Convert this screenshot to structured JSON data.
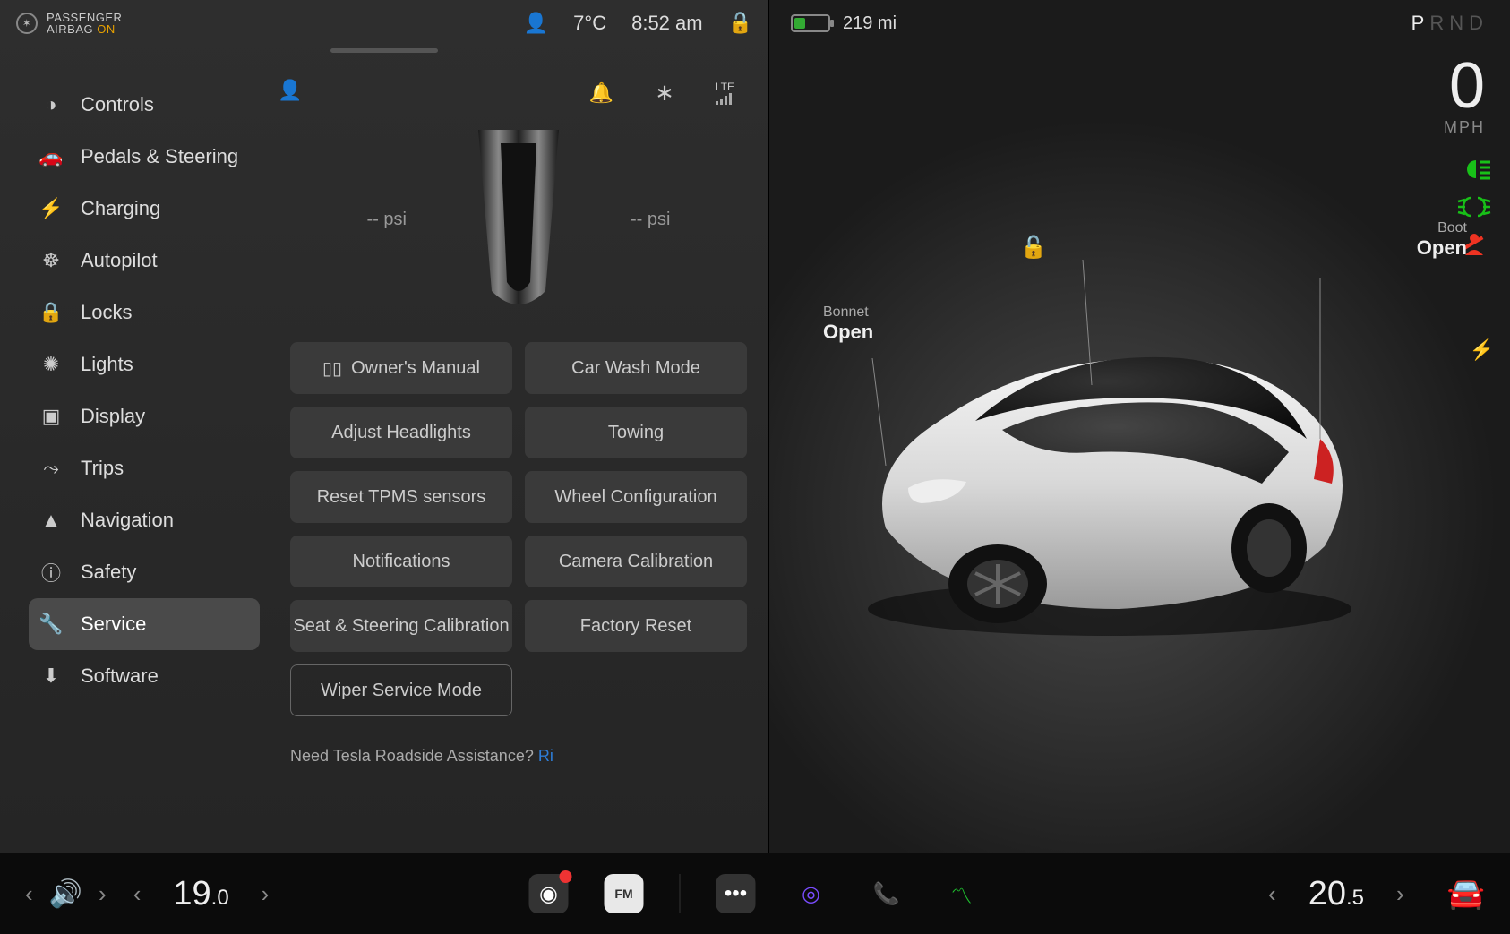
{
  "status": {
    "airbag_label_line1": "PASSENGER",
    "airbag_label_line2": "AIRBAG",
    "airbag_state": "ON",
    "temperature": "7°C",
    "time": "8:52 am"
  },
  "content_top": {
    "connection_label": "LTE"
  },
  "sidebar": {
    "items": [
      {
        "label": "Controls"
      },
      {
        "label": "Pedals & Steering"
      },
      {
        "label": "Charging"
      },
      {
        "label": "Autopilot"
      },
      {
        "label": "Locks"
      },
      {
        "label": "Lights"
      },
      {
        "label": "Display"
      },
      {
        "label": "Trips"
      },
      {
        "label": "Navigation"
      },
      {
        "label": "Safety"
      },
      {
        "label": "Service"
      },
      {
        "label": "Software"
      }
    ]
  },
  "tire": {
    "left_value": "--",
    "left_unit": "psi",
    "right_value": "--",
    "right_unit": "psi"
  },
  "service_buttons": {
    "owners_manual": "Owner's Manual",
    "car_wash": "Car Wash Mode",
    "headlights": "Adjust Headlights",
    "towing": "Towing",
    "reset_tpms": "Reset TPMS sensors",
    "wheel_config": "Wheel Configuration",
    "notifications": "Notifications",
    "camera_cal": "Camera Calibration",
    "seat_steering": "Seat & Steering Calibration",
    "factory_reset": "Factory Reset",
    "wiper": "Wiper Service Mode"
  },
  "assist": {
    "prefix": "Need Tesla Roadside Assistance? ",
    "link": "Ri"
  },
  "drive": {
    "range": "219 mi",
    "gear_p": "P",
    "gear_r": "R",
    "gear_n": "N",
    "gear_d": "D",
    "speed": "0",
    "speed_unit": "MPH",
    "bonnet_label": "Bonnet",
    "bonnet_action": "Open",
    "boot_label": "Boot",
    "boot_action": "Open"
  },
  "dock": {
    "left_temp_whole": "19",
    "left_temp_dec": ".0",
    "right_temp_whole": "20",
    "right_temp_dec": ".5",
    "fm_label": "FM"
  }
}
